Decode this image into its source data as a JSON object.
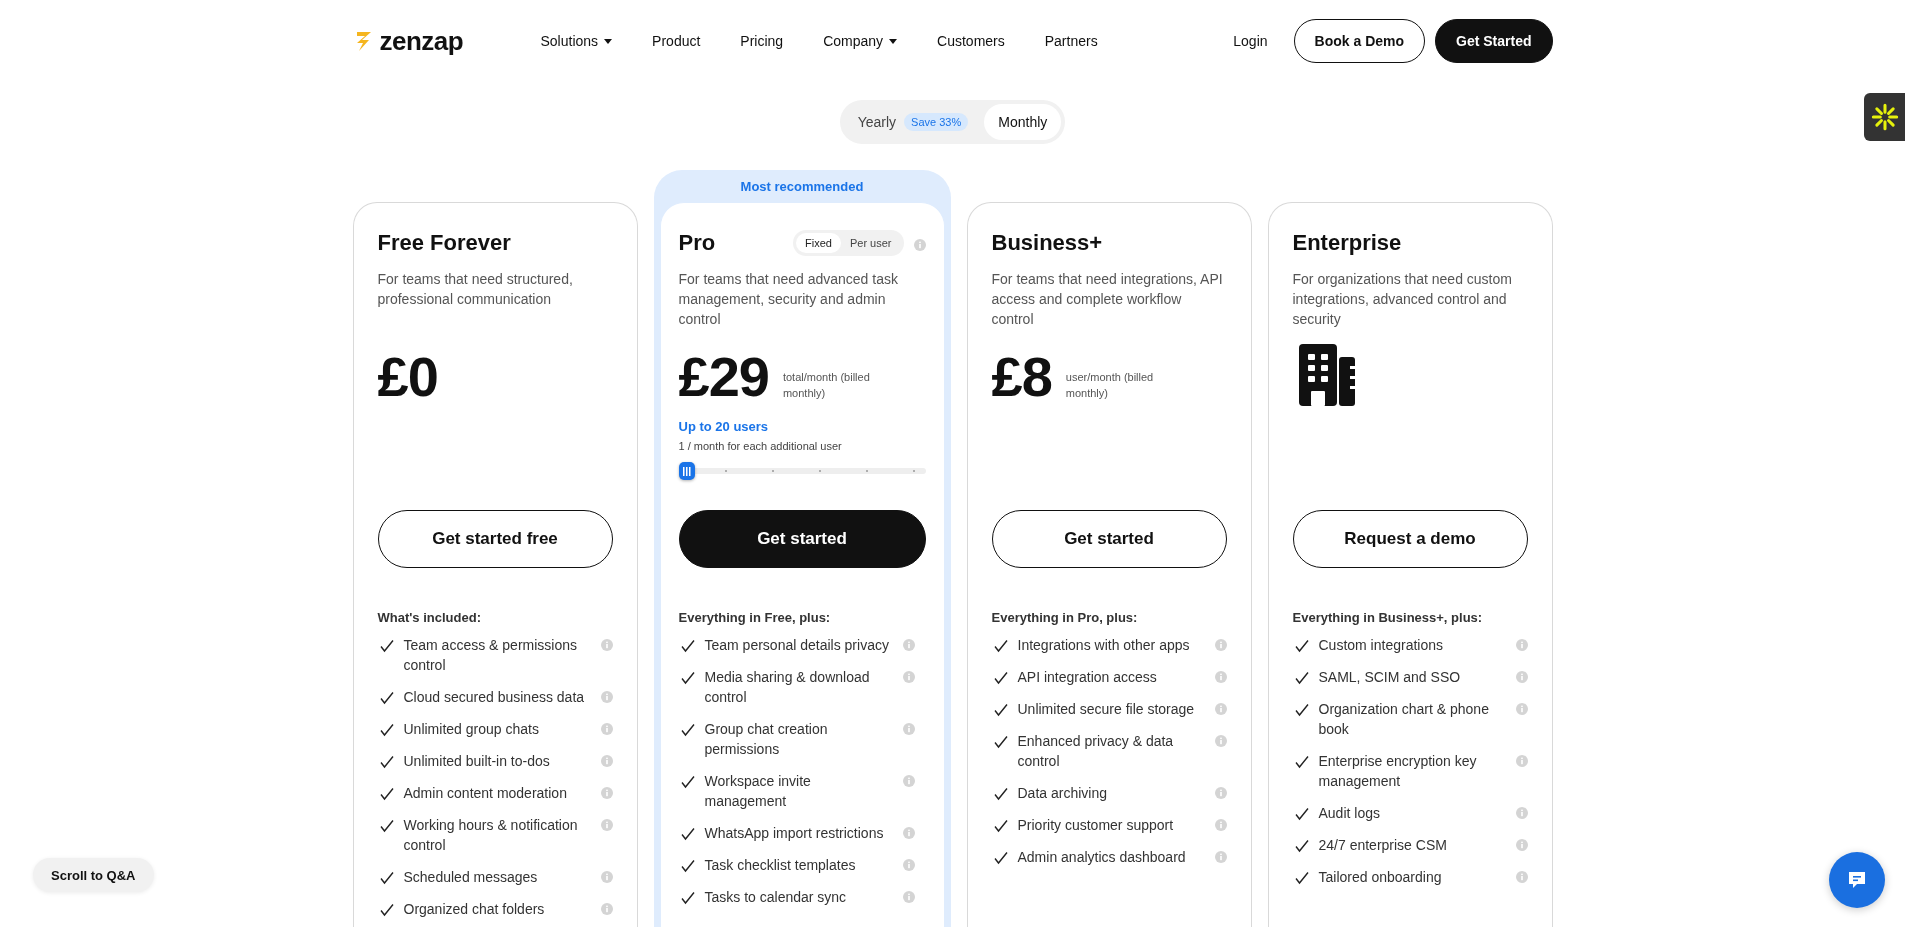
{
  "nav": {
    "logo": "zenzap",
    "links": [
      {
        "label": "Solutions",
        "dropdown": true
      },
      {
        "label": "Product",
        "dropdown": false
      },
      {
        "label": "Pricing",
        "dropdown": false
      },
      {
        "label": "Company",
        "dropdown": true
      },
      {
        "label": "Customers",
        "dropdown": false
      },
      {
        "label": "Partners",
        "dropdown": false
      }
    ],
    "login": "Login",
    "buttons": [
      {
        "label": "Book a Demo",
        "kind": "secondary"
      },
      {
        "label": "Get Started",
        "kind": "primary"
      }
    ]
  },
  "billing_toggle": [
    {
      "label": "Yearly",
      "badge": "Save 33%",
      "selected": false
    },
    {
      "label": "Monthly",
      "selected": true
    }
  ],
  "plans": [
    {
      "name": "Free Forever",
      "description": "For teams that need structured, professional communication",
      "price": "£0",
      "button": {
        "label": "Get started free",
        "kind": "secondary"
      },
      "features_heading": "What's included:",
      "features": [
        "Team access & permissions control",
        "Cloud secured business data",
        "Unlimited group chats",
        "Unlimited built-in to-dos",
        "Admin content moderation",
        "Working hours & notification control",
        "Scheduled messages",
        "Organized chat folders"
      ]
    },
    {
      "recommended_label": "Most recommended",
      "name": "Pro",
      "pricing_mode": [
        {
          "label": "Fixed",
          "selected": true
        },
        {
          "label": "Per user",
          "selected": false
        }
      ],
      "description": "For teams that need advanced task management, security and admin control",
      "price": "£29",
      "price_note": "total/month  (billed monthly)",
      "users_label": "Up to 20 users",
      "users_note": "1 / month for each additional user",
      "slider": {
        "level": 0
      },
      "button": {
        "label": "Get started",
        "kind": "primary"
      },
      "features_heading": "Everything in Free, plus:",
      "features": [
        "Team personal details privacy",
        "Media sharing & download control",
        "Group chat creation permissions",
        "Workspace invite management",
        "WhatsApp import restrictions",
        "Task checklist templates",
        "Tasks to calendar sync"
      ]
    },
    {
      "name": "Business+",
      "description": "For teams that need integrations, API access and complete workflow control",
      "price": "£8",
      "price_note": "user/month (billed monthly)",
      "button": {
        "label": "Get started",
        "kind": "secondary"
      },
      "features_heading": "Everything in Pro, plus:",
      "features": [
        "Integrations with other apps",
        "API integration access",
        "Unlimited secure file storage",
        "Enhanced privacy & data control",
        "Data archiving",
        "Priority customer support",
        "Admin analytics dashboard"
      ]
    },
    {
      "name": "Enterprise",
      "description": "For organizations that need custom integrations, advanced control and security",
      "button": {
        "label": "Request a demo",
        "kind": "secondary"
      },
      "features_heading": "Everything in Business+, plus:",
      "features": [
        "Custom integrations",
        "SAML, SCIM and SSO",
        "Organization chart & phone book",
        "Enterprise encryption key management",
        "Audit logs",
        "24/7 enterprise CSM",
        "Tailored onboarding"
      ]
    }
  ],
  "scroll_button": "Scroll to Q&A"
}
